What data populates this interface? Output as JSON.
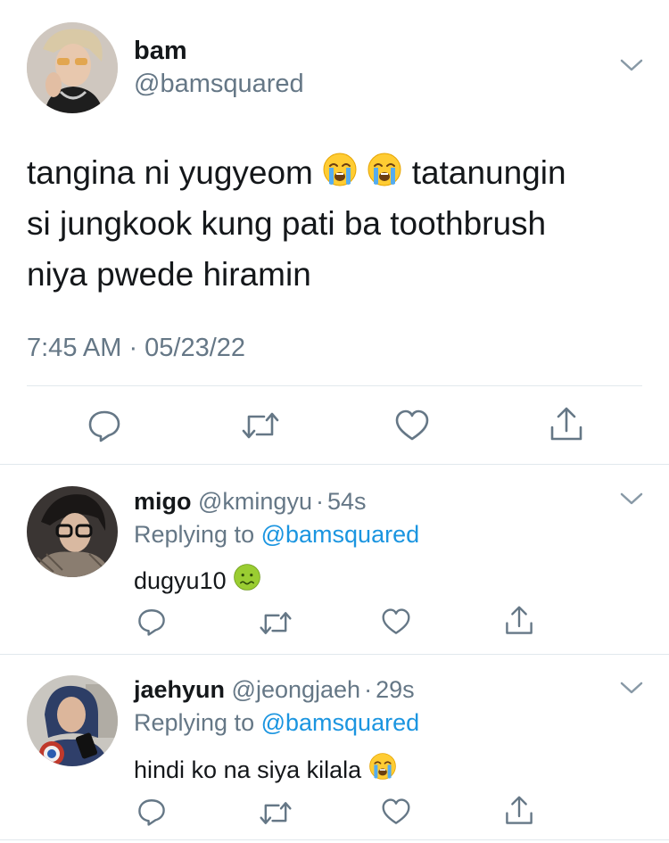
{
  "main_tweet": {
    "display_name": "bam",
    "handle": "@bamsquared",
    "text_line1": "tangina ni yugyeom",
    "text_line1_after": "tatanungin",
    "text_line2": "si jungkook kung pati ba toothbrush",
    "text_line3": "niya pwede hiramin",
    "timestamp": "7:45 AM · 05/23/22",
    "emojis": [
      "loudly-crying-face",
      "loudly-crying-face"
    ]
  },
  "replies": [
    {
      "display_name": "migo",
      "handle": "@kmingyu",
      "sep": "·",
      "time": "54s",
      "replying_prefix": "Replying to",
      "replying_to": "@bamsquared",
      "text": "dugyu10",
      "emoji": "nauseated-face"
    },
    {
      "display_name": "jaehyun",
      "handle": "@jeongjaeh",
      "sep": "·",
      "time": "29s",
      "replying_prefix": "Replying to",
      "replying_to": "@bamsquared",
      "text": "hindi ko na siya kilala",
      "emoji": "loudly-crying-face"
    }
  ],
  "colors": {
    "text": "#14171a",
    "secondary": "#657786",
    "link": "#1b95e0",
    "divider": "#e1e8ed"
  }
}
